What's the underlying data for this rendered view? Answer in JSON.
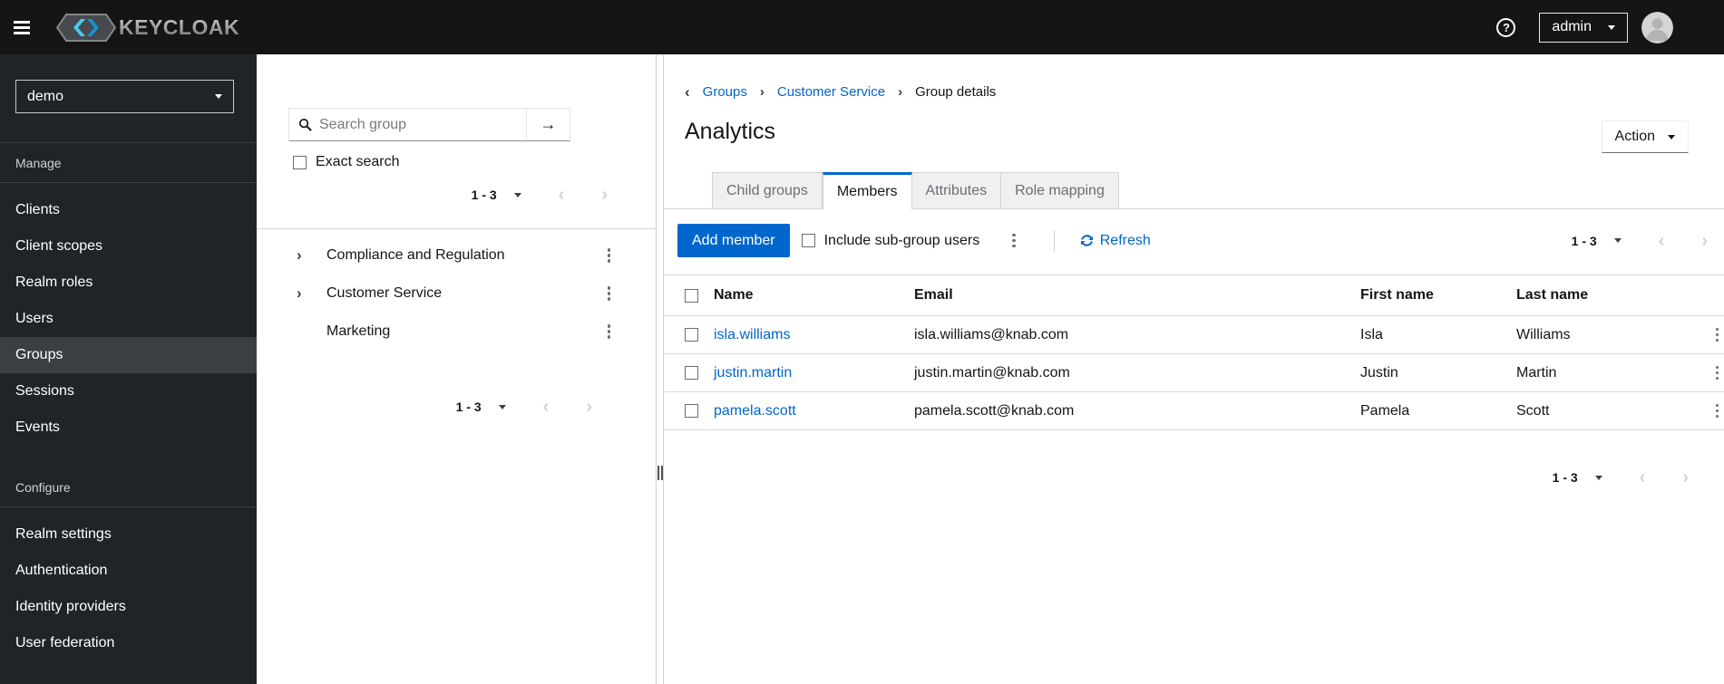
{
  "colors": {
    "accent": "#0066cc",
    "masthead_bg": "#151515",
    "sidebar_bg": "#212427",
    "sidebar_selected_bg": "#3c3f42",
    "link": "#0066cc",
    "muted_text": "#6a6e73",
    "border": "#d2d2d2",
    "brand_cyan_light": "#4cc9f0",
    "brand_cyan_dark": "#1195d3"
  },
  "icons": {
    "hamburger": "bars-icon",
    "help": "?",
    "avatar": "user-circle",
    "search": "magnifier",
    "search_go": "→",
    "angle_left": "‹",
    "angle_right": "›",
    "expand_chevron": "›",
    "breadcrumb_back": "‹",
    "kebab": "vertical-dots",
    "refresh": "sync-arrows"
  },
  "header": {
    "brand": "KEYCLOAK",
    "user_menu": "admin"
  },
  "sidebar": {
    "realm": "demo",
    "sections": [
      {
        "label": "Manage",
        "items": [
          {
            "label": "Clients"
          },
          {
            "label": "Client scopes"
          },
          {
            "label": "Realm roles"
          },
          {
            "label": "Users"
          },
          {
            "label": "Groups",
            "selected": true
          },
          {
            "label": "Sessions"
          },
          {
            "label": "Events"
          }
        ]
      },
      {
        "label": "Configure",
        "items": [
          {
            "label": "Realm settings"
          },
          {
            "label": "Authentication"
          },
          {
            "label": "Identity providers"
          },
          {
            "label": "User federation"
          }
        ]
      }
    ]
  },
  "group_panel": {
    "search_placeholder": "Search group",
    "exact_search_label": "Exact search",
    "pagination_top": {
      "range": "1 - 3"
    },
    "tree": [
      {
        "label": "Compliance and Regulation",
        "expandable": true
      },
      {
        "label": "Customer Service",
        "expandable": true
      },
      {
        "label": "Marketing",
        "expandable": false
      }
    ],
    "pagination_bottom": {
      "range": "1 - 3"
    }
  },
  "main": {
    "breadcrumb": {
      "items": [
        {
          "label": "Groups",
          "link": true
        },
        {
          "label": "Customer Service",
          "link": true
        },
        {
          "label": "Group details",
          "link": false
        }
      ]
    },
    "title": "Analytics",
    "action_button": "Action",
    "tabs": [
      {
        "label": "Child groups"
      },
      {
        "label": "Members",
        "selected": true
      },
      {
        "label": "Attributes"
      },
      {
        "label": "Role mapping"
      }
    ],
    "toolbar": {
      "add_member": "Add member",
      "include_subgroups": "Include sub-group users",
      "refresh": "Refresh",
      "pagination": {
        "range": "1 - 3"
      }
    },
    "table": {
      "columns": [
        "Name",
        "Email",
        "First name",
        "Last name"
      ],
      "rows": [
        {
          "name": "isla.williams",
          "email": "isla.williams@knab.com",
          "first_name": "Isla",
          "last_name": "Williams"
        },
        {
          "name": "justin.martin",
          "email": "justin.martin@knab.com",
          "first_name": "Justin",
          "last_name": "Martin"
        },
        {
          "name": "pamela.scott",
          "email": "pamela.scott@knab.com",
          "first_name": "Pamela",
          "last_name": "Scott"
        }
      ]
    },
    "pagination_bottom": {
      "range": "1 - 3"
    }
  }
}
